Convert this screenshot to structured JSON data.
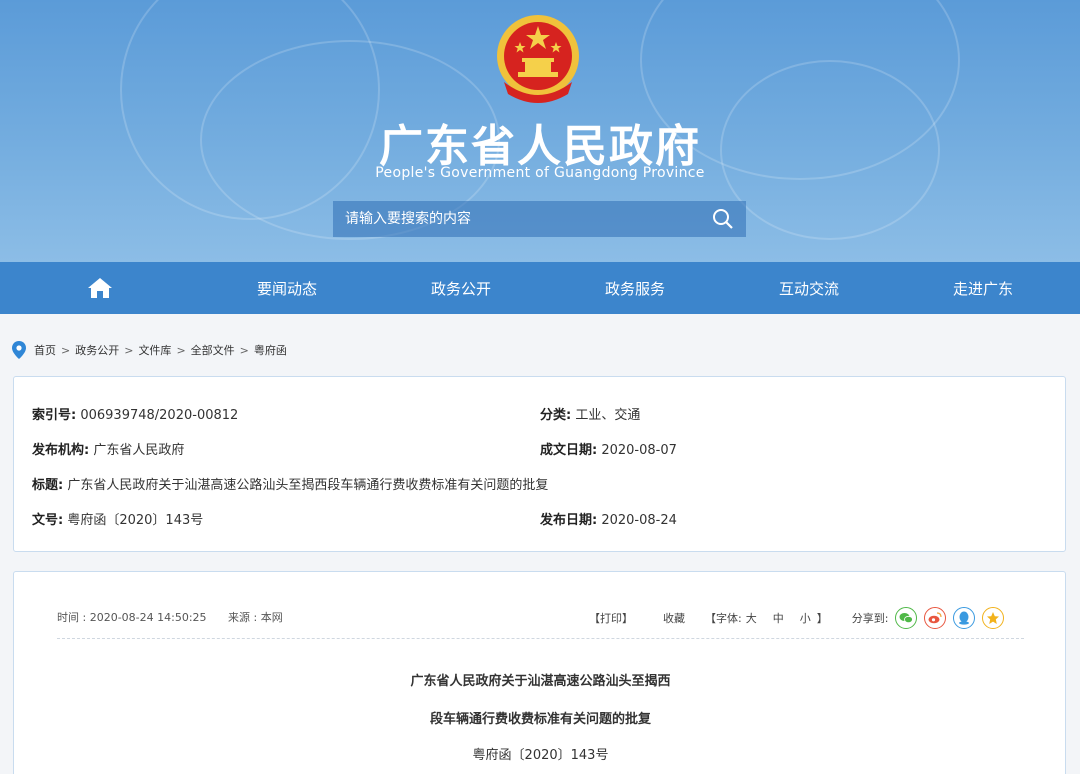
{
  "header": {
    "title": "广东省人民政府",
    "subtitle": "People's Government of Guangdong Province",
    "emblem_icon": "national-emblem-icon"
  },
  "search": {
    "placeholder": "请输入要搜索的内容"
  },
  "nav": {
    "home_icon": "home-icon",
    "items": [
      "要闻动态",
      "政务公开",
      "政务服务",
      "互动交流",
      "走进广东"
    ]
  },
  "breadcrumb": [
    "首页",
    "政务公开",
    "文件库",
    "全部文件",
    "粤府函"
  ],
  "info": {
    "index_label": "索引号:",
    "index_value": "006939748/2020-00812",
    "category_label": "分类:",
    "category_value": "工业、交通",
    "issuer_label": "发布机构:",
    "issuer_value": "广东省人民政府",
    "written_label": "成文日期:",
    "written_value": "2020-08-07",
    "title_label": "标题:",
    "title_value": "广东省人民政府关于汕湛高速公路汕头至揭西段车辆通行费收费标准有关问题的批复",
    "docno_label": "文号:",
    "docno_value": "粤府函〔2020〕143号",
    "published_label": "发布日期:",
    "published_value": "2020-08-24"
  },
  "article": {
    "time": "时间 : 2020-08-24 14:50:25",
    "source": "来源 : 本网",
    "print": "【打印】",
    "favorite": "收藏",
    "font_open": "【字体:",
    "font_large": "大",
    "font_medium": "中",
    "font_small": "小",
    "font_close": "】",
    "share_label": "分享到:",
    "share_icons": [
      "wechat-icon",
      "weibo-icon",
      "qq-icon",
      "qzone-icon"
    ],
    "title_line1": "广东省人民政府关于汕湛高速公路汕头至揭西",
    "title_line2": "段车辆通行费收费标准有关问题的批复",
    "doc_number": "粤府函〔2020〕143号"
  },
  "colors": {
    "header_bg": "#5b9bd8",
    "nav_bg": "#3c85cc",
    "border": "#c9dcef",
    "wechat": "#4fb847",
    "weibo": "#e8563f",
    "qq": "#3a9ae0",
    "qzone": "#f2b21c"
  }
}
